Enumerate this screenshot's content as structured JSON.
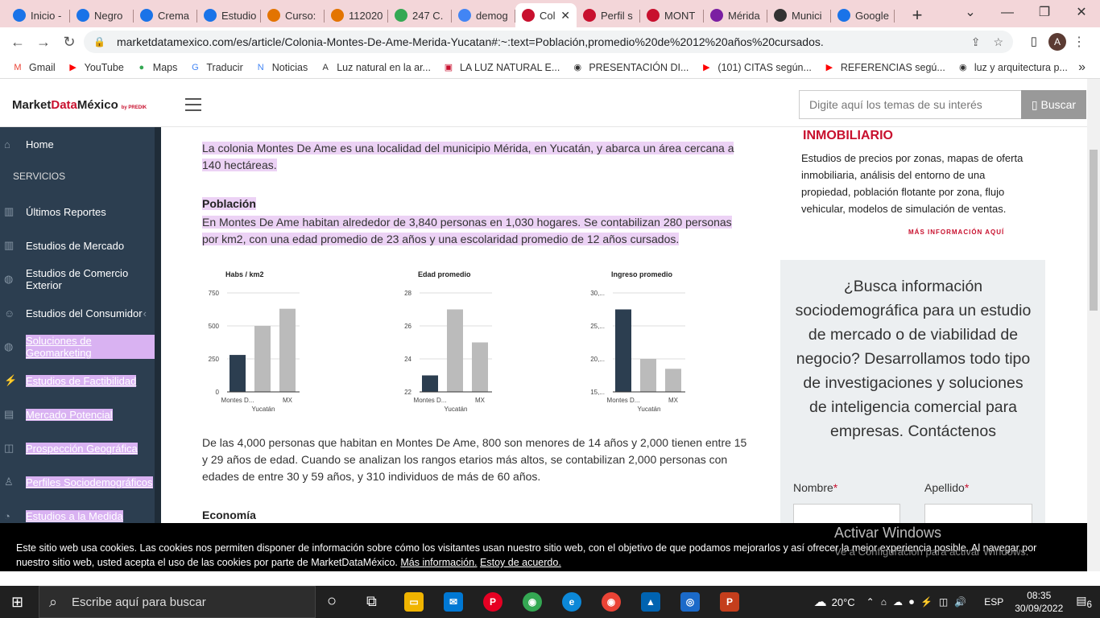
{
  "browser": {
    "tabs": [
      {
        "label": "Inicio -",
        "color": "#1a73e8"
      },
      {
        "label": "Negro",
        "color": "#1a73e8"
      },
      {
        "label": "Crema",
        "color": "#1a73e8"
      },
      {
        "label": "Estudio",
        "color": "#1a73e8"
      },
      {
        "label": "Curso:",
        "color": "#e37400"
      },
      {
        "label": "112020",
        "color": "#e37400"
      },
      {
        "label": "247 C.",
        "color": "#34a853"
      },
      {
        "label": "demog",
        "color": "#4285f4"
      },
      {
        "label": "Col",
        "color": "#c8102e"
      },
      {
        "label": "Perfil s",
        "color": "#c8102e"
      },
      {
        "label": "MONT",
        "color": "#c8102e"
      },
      {
        "label": "Mérida",
        "color": "#7b1fa2"
      },
      {
        "label": "Munici",
        "color": "#333333"
      },
      {
        "label": "Google",
        "color": "#1a73e8"
      }
    ],
    "active_close": "✕",
    "new_tab": "+",
    "url": "marketdatamexico.com/es/article/Colonia-Montes-De-Ame-Merida-Yucatan#:~:text=Población,promedio%20de%2012%20años%20cursados.",
    "avatar": "A",
    "bookmarks": [
      {
        "label": "Gmail",
        "icon": "M",
        "color": "#ea4335"
      },
      {
        "label": "YouTube",
        "icon": "▶",
        "color": "#ff0000"
      },
      {
        "label": "Maps",
        "icon": "●",
        "color": "#34a853"
      },
      {
        "label": "Traducir",
        "icon": "G",
        "color": "#4285f4"
      },
      {
        "label": "Noticias",
        "icon": "N",
        "color": "#4285f4"
      },
      {
        "label": "Luz natural en la ar...",
        "icon": "A",
        "color": "#333333"
      },
      {
        "label": "LA LUZ NATURAL E...",
        "icon": "▣",
        "color": "#c8102e"
      },
      {
        "label": "PRESENTACIÓN DI...",
        "icon": "◉",
        "color": "#333333"
      },
      {
        "label": "(101) CITAS según...",
        "icon": "▶",
        "color": "#ff0000"
      },
      {
        "label": "REFERENCIAS segú...",
        "icon": "▶",
        "color": "#ff0000"
      },
      {
        "label": "luz y arquitectura p...",
        "icon": "◉",
        "color": "#333333"
      }
    ],
    "bookmarks_more": "»"
  },
  "site": {
    "logo_a": "Market",
    "logo_b": "Data",
    "logo_c": "México",
    "logo_by": "by PREDIK",
    "search_placeholder": "Digite aquí los temas de su interés",
    "search_button": "Buscar"
  },
  "sidebar": {
    "home": "Home",
    "section": "SERVICIOS",
    "items": [
      {
        "label": "Últimos Reportes",
        "hl": false
      },
      {
        "label": "Estudios de Mercado",
        "hl": false
      },
      {
        "label": "Estudios de Comercio Exterior",
        "hl": false
      },
      {
        "label": "Estudios del Consumidor",
        "hl": false
      },
      {
        "label": "Soluciones de Geomarketing",
        "hl": true
      },
      {
        "label": "Estudios de Factibilidad",
        "hl": true
      },
      {
        "label": "Mercado Potencial",
        "hl": true
      },
      {
        "label": "Prospección Geográfica",
        "hl": true
      },
      {
        "label": "Perfiles Sociodemográficos",
        "hl": true
      },
      {
        "label": "Estudios a la Medida",
        "hl": true
      }
    ]
  },
  "article": {
    "intro": "La colonia Montes De Ame es una localidad del municipio Mérida, en Yucatán, y abarca un área cercana a 140 hectáreas.",
    "pob_title": "Población",
    "pob_text": "En Montes De Ame habitan alrededor de 3,840 personas en 1,030 hogares. Se contabilizan 280 personas por km2, con una edad promedio de 23 años y una escolaridad promedio de 12 años cursados.",
    "ages_text": "De las 4,000 personas que habitan en Montes De Ame, 800 son menores de 14 años y 2,000 tienen entre 15 y 29 años de edad. Cuando se analizan los rangos etarios más altos, se contabilizan 2,000 personas con edades de entre 30 y 59 años, y 310 individuos de más de 60 años.",
    "eco_title": "Economía"
  },
  "chart_data": [
    {
      "type": "bar",
      "title": "Habs / km2",
      "categories": [
        "Montes D...",
        "Yucatán",
        "MX"
      ],
      "values": [
        280,
        500,
        630
      ],
      "ylim": [
        0,
        750
      ],
      "ticks": [
        "0",
        "250",
        "500",
        "750"
      ],
      "colors": [
        "#2c3e50",
        "#bbbbbb",
        "#bbbbbb"
      ]
    },
    {
      "type": "bar",
      "title": "Edad promedio",
      "categories": [
        "Montes D...",
        "Yucatán",
        "MX"
      ],
      "values": [
        23,
        27,
        25
      ],
      "ylim": [
        22,
        28
      ],
      "ticks": [
        "22",
        "24",
        "26",
        "28"
      ],
      "colors": [
        "#2c3e50",
        "#bbbbbb",
        "#bbbbbb"
      ]
    },
    {
      "type": "bar",
      "title": "Ingreso promedio",
      "categories": [
        "Montes D...",
        "Yucatán",
        "MX"
      ],
      "values": [
        27500,
        20000,
        18500
      ],
      "ylim": [
        15000,
        30000
      ],
      "ticks": [
        "15,...",
        "20,...",
        "25,...",
        "30,..."
      ],
      "colors": [
        "#2c3e50",
        "#bbbbbb",
        "#bbbbbb"
      ]
    }
  ],
  "aside": {
    "title": "INMOBILIARIO",
    "desc": "Estudios de precios por zonas, mapas de oferta inmobiliaria, análisis del entorno de una propiedad, población flotante por zona, flujo vehicular, modelos de simulación de ventas.",
    "more": "MÁS INFORMACIÓN AQUÍ",
    "promo": "¿Busca información sociodemográfica para un estudio de mercado o de viabilidad de negocio? Desarrollamos todo tipo de investigaciones y soluciones de inteligencia comercial para empresas. Contáctenos",
    "nombre": "Nombre",
    "apellido": "Apellido",
    "req": "*"
  },
  "cookie": {
    "text": "Este sitio web usa cookies. Las cookies nos permiten disponer de información sobre cómo los visitantes usan nuestro sitio web, con el objetivo de que podamos mejorarlos y así ofrecer la mejor experiencia posible. Al navegar por nuestro sitio web, usted acepta el uso de las cookies por parte de MarketDataMéxico.",
    "more": "Más información.",
    "ok": "Estoy de acuerdo."
  },
  "watermark": {
    "title": "Activar Windows",
    "sub": "Ve a Configuración para activar Windows."
  },
  "taskbar": {
    "search": "Escribe aquí para buscar",
    "weather": "20°C",
    "lang": "ESP",
    "time": "08:35",
    "date": "30/09/2022",
    "notif": "6"
  }
}
